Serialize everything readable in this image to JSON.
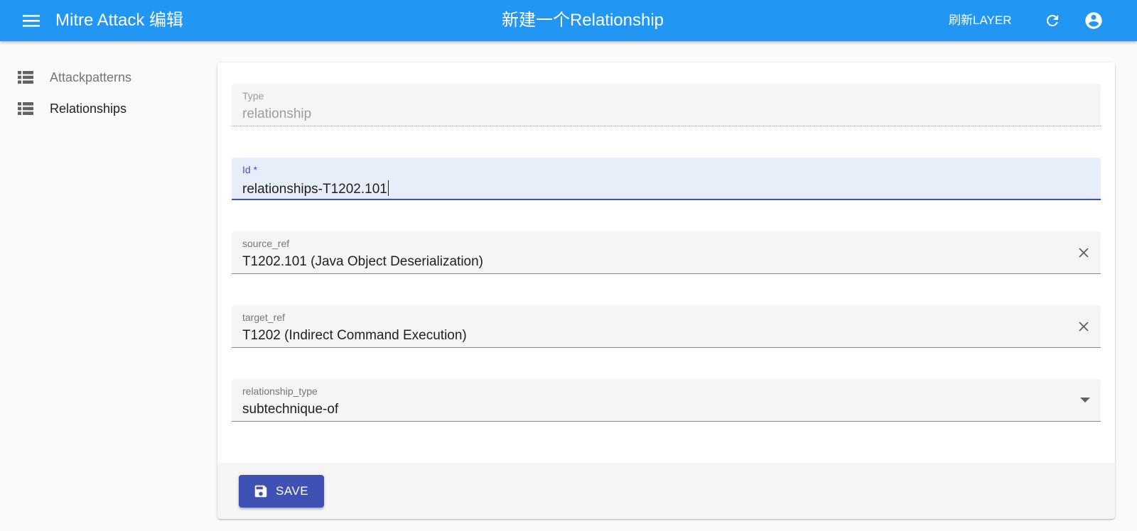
{
  "app": {
    "title": "Mitre Attack 编辑",
    "page_title": "新建一个Relationship",
    "refresh_layer_label": "刷新LAYER"
  },
  "icons": {
    "menu": "menu-icon",
    "refresh": "refresh-icon",
    "account": "account-circle-icon",
    "list": "view-list-icon",
    "clear": "close-icon",
    "dropdown": "arrow-drop-down-icon",
    "save": "floppy-disk-icon"
  },
  "colors": {
    "appbar": "#2196f3",
    "primary": "#3f51b5",
    "field_bg": "#f5f5f5",
    "focused_field_bg": "#e8eef9"
  },
  "sidebar": {
    "items": [
      {
        "label": "Attackpatterns",
        "active": false
      },
      {
        "label": "Relationships",
        "active": true
      }
    ]
  },
  "form": {
    "type": {
      "label": "Type",
      "value": "relationship",
      "disabled": true
    },
    "id": {
      "label": "Id *",
      "value": "relationships-T1202.101",
      "focused": true
    },
    "source_ref": {
      "label": "source_ref",
      "value": "T1202.101 (Java Object Deserialization)"
    },
    "target_ref": {
      "label": "target_ref",
      "value": "T1202 (Indirect Command Execution)"
    },
    "relationship_type": {
      "label": "relationship_type",
      "value": "subtechnique-of"
    }
  },
  "toolbar": {
    "save_label": "SAVE"
  }
}
